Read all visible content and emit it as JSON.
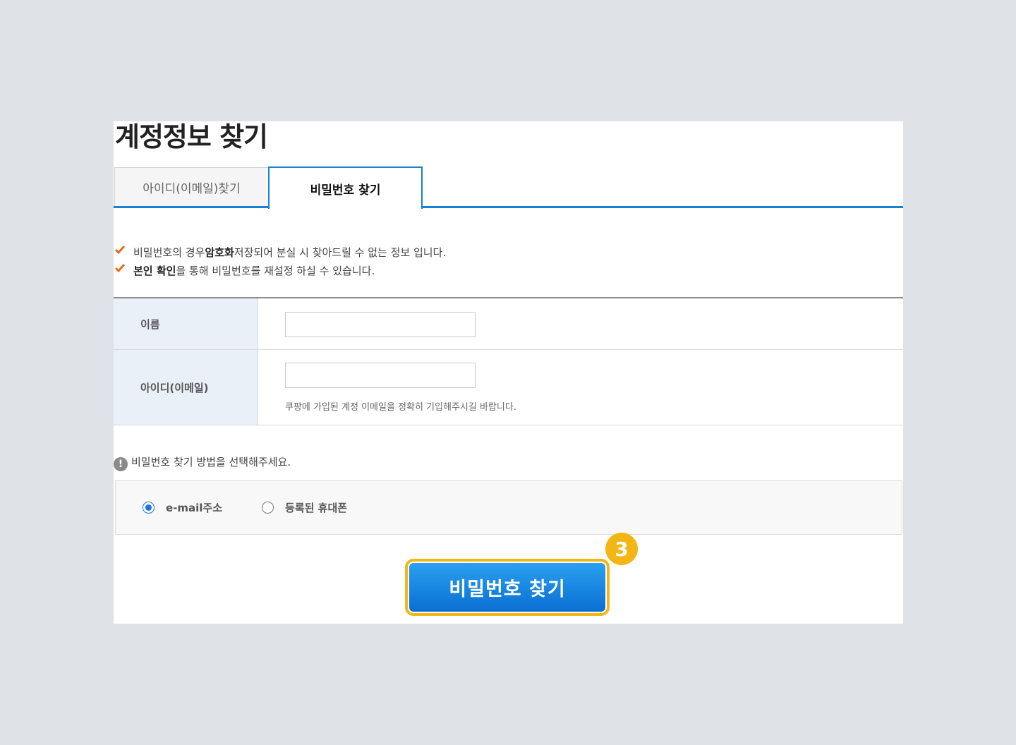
{
  "page": {
    "title": "계정정보 찾기"
  },
  "tabs": {
    "find_id_label": "아이디(이메일)찾기",
    "find_password_label": "비밀번호 찾기"
  },
  "notes": {
    "line1_prefix": "비밀번호의 경우 ",
    "line1_bold": "암호화",
    "line1_suffix": " 저장되어 분실 시 찾아드릴 수 없는 정보 입니다.",
    "line2_bold": "본인 확인",
    "line2_suffix": "을 통해 비밀번호를 재설정 하실 수 있습니다."
  },
  "form": {
    "name_label": "이름",
    "name_value": "",
    "id_label": "아이디(이메일)",
    "id_value": "",
    "id_help": "쿠팡에 가입된 계정 이메일을 정확히 기입해주시길 바랍니다."
  },
  "method": {
    "prompt": "비밀번호 찾기 방법을 선택해주세요.",
    "alert_glyph": "!",
    "options": [
      {
        "label": "e-mail주소",
        "selected": true
      },
      {
        "label": "등록된 휴대폰",
        "selected": false
      }
    ]
  },
  "submit": {
    "label": "비밀번호 찾기"
  },
  "annotation": {
    "step_number": "3"
  },
  "colors": {
    "accent_blue": "#1a80d0",
    "check_orange": "#e86a1c",
    "highlight_yellow": "#f3b715",
    "background": "#dfe2e7"
  }
}
